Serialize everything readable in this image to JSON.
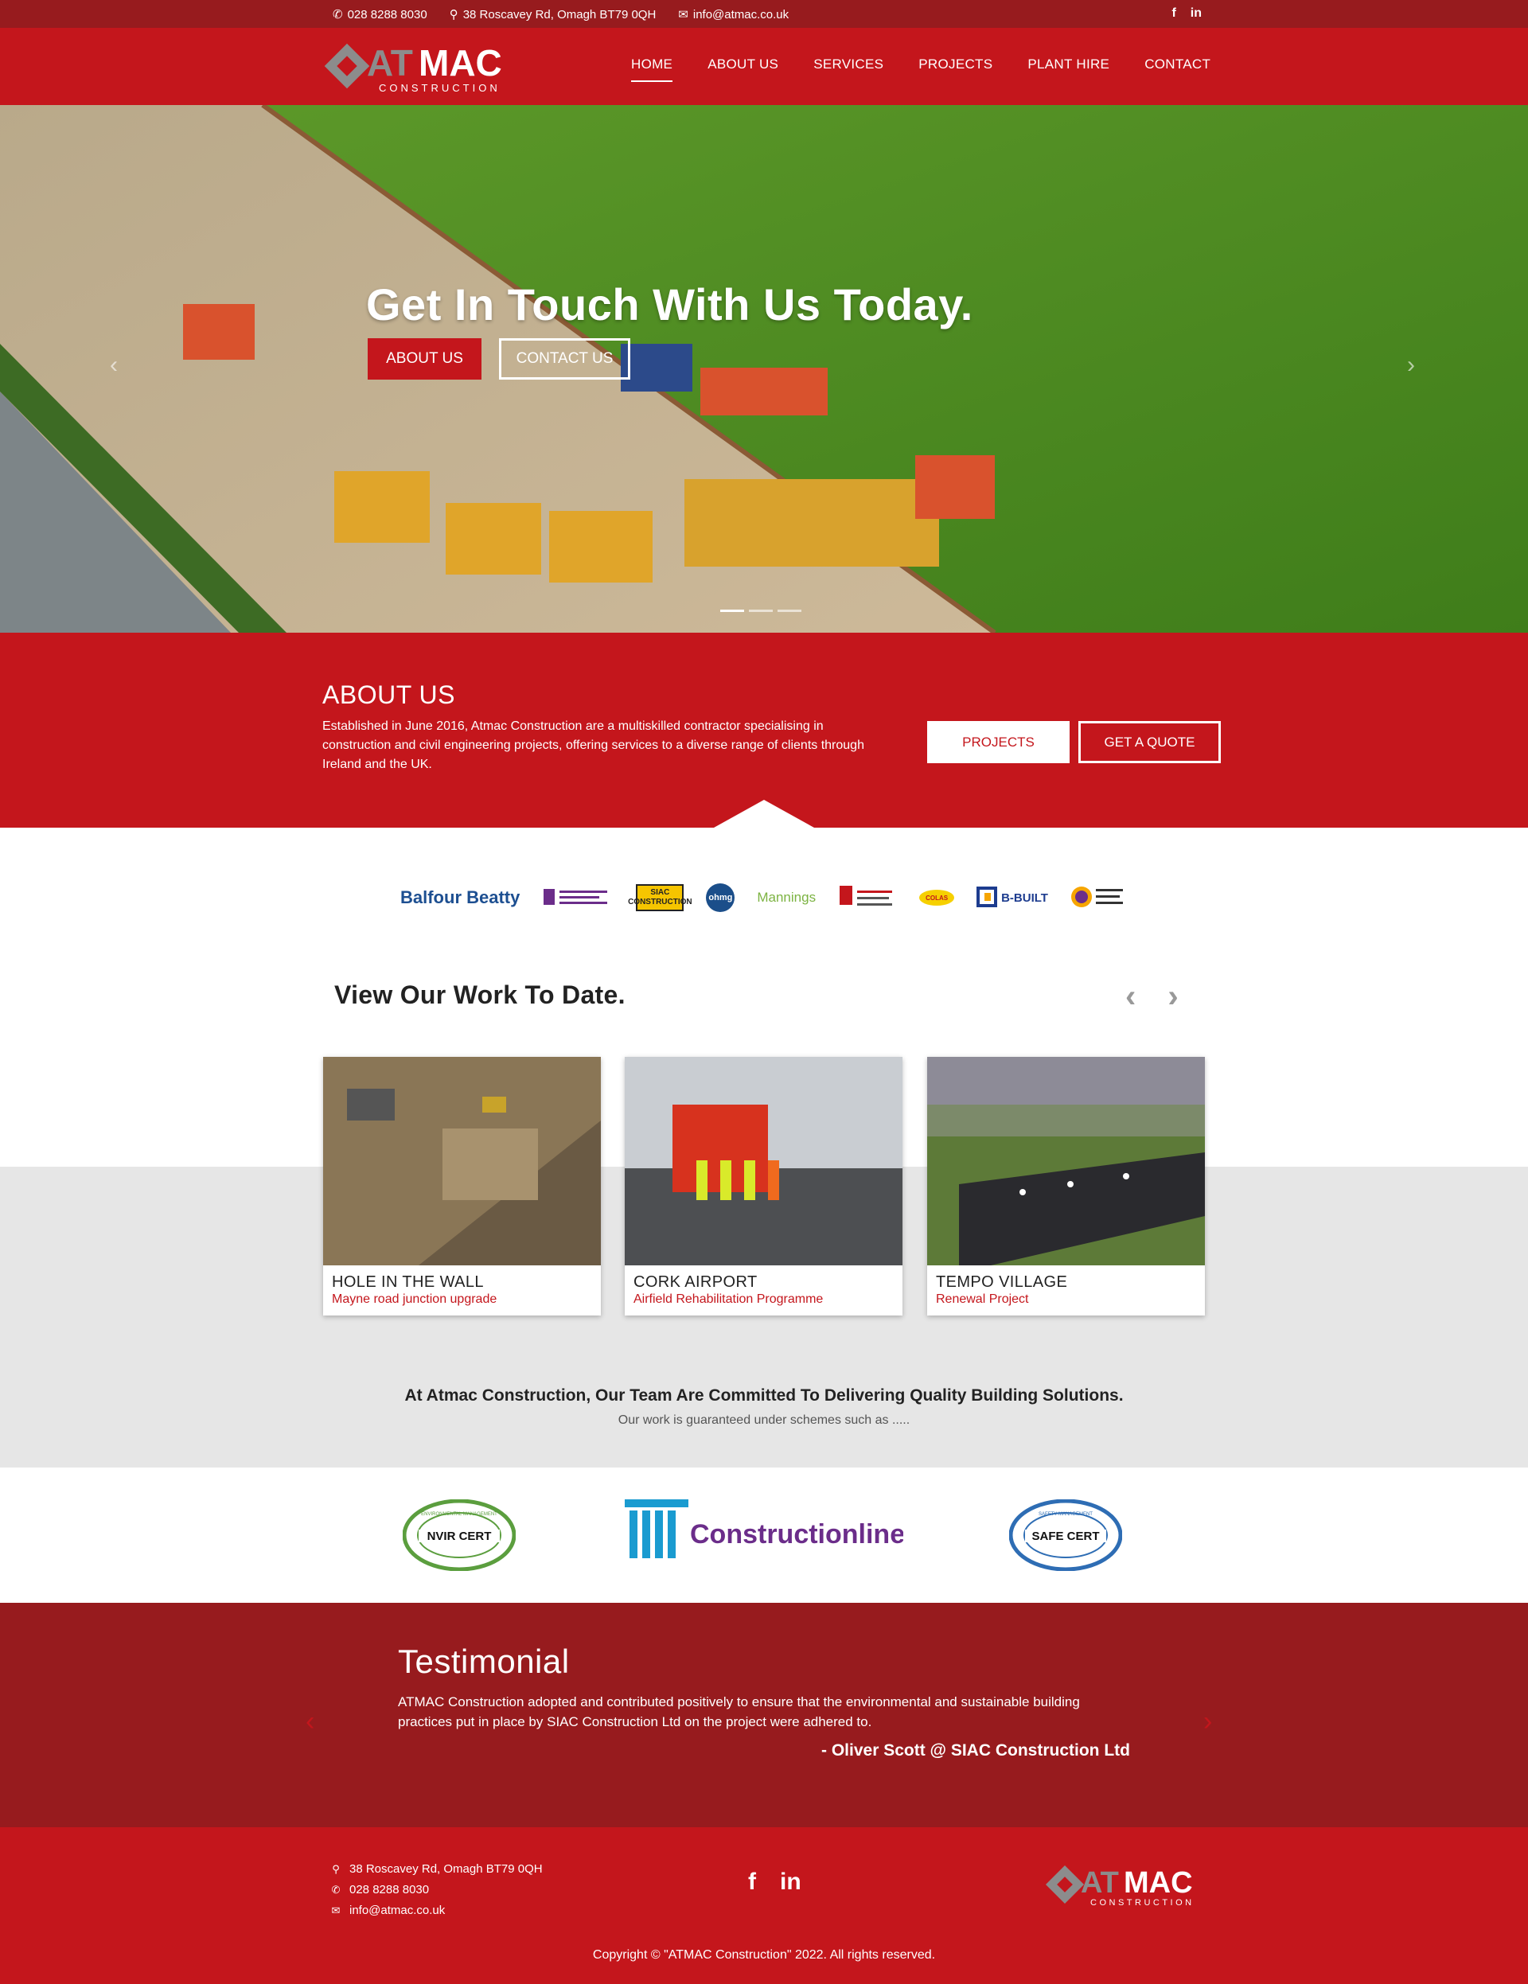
{
  "topbar": {
    "phone": "028 8288 8030",
    "address": "38 Roscavey Rd, Omagh BT79 0QH",
    "email": "info@atmac.co.uk",
    "social": [
      "f",
      "in"
    ]
  },
  "brand": {
    "name_a": "AT",
    "name_b": "MAC",
    "tagline": "CONSTRUCTION"
  },
  "nav": {
    "items": [
      {
        "label": "HOME",
        "active": true
      },
      {
        "label": "ABOUT US"
      },
      {
        "label": "SERVICES"
      },
      {
        "label": "PROJECTS"
      },
      {
        "label": "PLANT HIRE"
      },
      {
        "label": "CONTACT"
      }
    ]
  },
  "hero": {
    "title": "Get In Touch With Us Today.",
    "btn_about": "ABOUT US",
    "btn_contact": "CONTACT US",
    "prev_arrow": "‹",
    "next_arrow": "›"
  },
  "about": {
    "title": "ABOUT US",
    "text": "Established in June 2016, Atmac Construction are a multiskilled contractor specialising in construction and civil engineering projects, offering services to a diverse range of clients through Ireland and the UK.",
    "btn_projects": "PROJECTS",
    "btn_quote": "GET A QUOTE"
  },
  "clients": [
    "Balfour Beatty",
    "SIAC CONSTRUCTION",
    "ohmg",
    "Mannings",
    "COLAS",
    "B-BUILT"
  ],
  "work": {
    "title": "View Our Work To Date.",
    "cards": [
      {
        "title": "HOLE IN THE WALL",
        "subtitle": "Mayne road junction upgrade"
      },
      {
        "title": "CORK AIRPORT",
        "subtitle": "Airfield Rehabilitation Programme"
      },
      {
        "title": "TEMPO VILLAGE",
        "subtitle": "Renewal Project"
      }
    ]
  },
  "commitment": {
    "title": "At Atmac Construction, Our Team Are Committed To Delivering Quality Building Solutions.",
    "subtitle": "Our work is guaranteed under schemes such as ....."
  },
  "accreditations": {
    "envirocert": "NVIR CERT",
    "envirocert_ring": "ENVIRONMENTAL MANAGEMENT",
    "constructionline": "Constructionline",
    "safecert": "SAFE CERT",
    "safecert_ring": "SAFETY MANAGEMENT"
  },
  "testimonial": {
    "title": "Testimonial",
    "quote": "ATMAC Construction adopted and contributed positively to ensure that the environmental and sustainable building practices put in place by SIAC Construction Ltd on the project were adhered to.",
    "author": "- Oliver Scott @ SIAC Construction Ltd"
  },
  "footer": {
    "address": "38 Roscavey Rd, Omagh BT79 0QH",
    "phone": "028 8288 8030",
    "email": "info@atmac.co.uk",
    "copyright": "Copyright © \"ATMAC Construction\" 2022. All rights reserved."
  },
  "colors": {
    "brand_red": "#c4161c",
    "dark_red": "#971b1e",
    "grey": "#e6e6e6"
  }
}
